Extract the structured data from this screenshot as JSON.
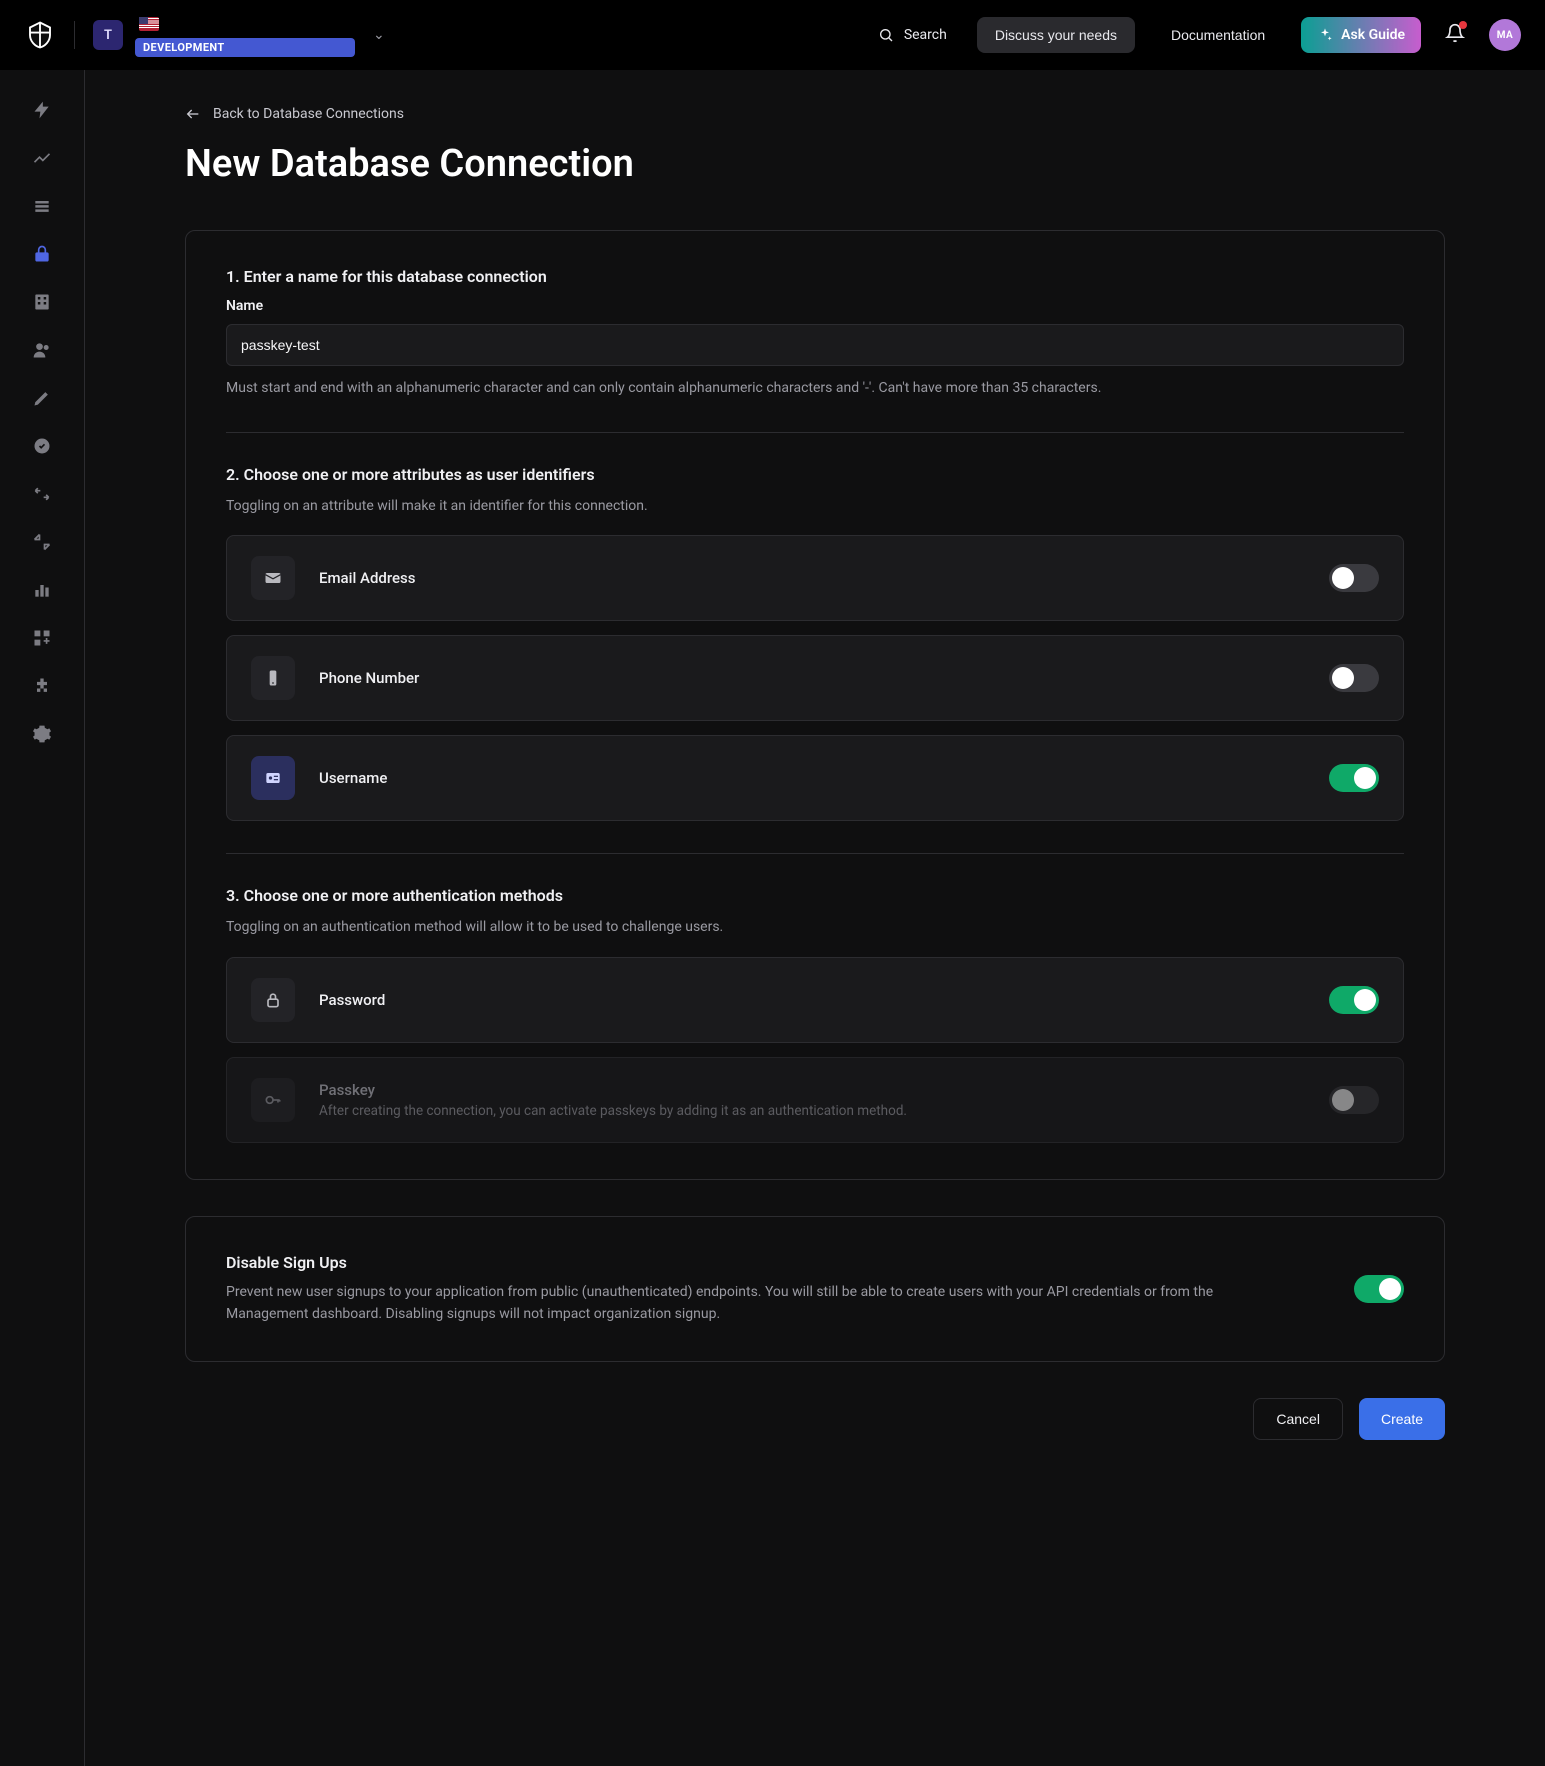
{
  "header": {
    "tenant_initial": "T",
    "env_badge": "DEVELOPMENT",
    "search_label": "Search",
    "discuss_label": "Discuss your needs",
    "docs_label": "Documentation",
    "ask_guide_label": "Ask Guide",
    "avatar_initials": "MA"
  },
  "back_link": "Back to Database Connections",
  "page_title": "New Database Connection",
  "section1": {
    "heading": "1. Enter a name for this database connection",
    "label": "Name",
    "value": "passkey-test",
    "hint": "Must start and end with an alphanumeric character and can only contain alphanumeric characters and '-'. Can't have more than 35 characters."
  },
  "section2": {
    "heading": "2. Choose one or more attributes as user identifiers",
    "sub": "Toggling on an attribute will make it an identifier for this connection.",
    "rows": [
      {
        "label": "Email Address",
        "on": false
      },
      {
        "label": "Phone Number",
        "on": false
      },
      {
        "label": "Username",
        "on": true
      }
    ]
  },
  "section3": {
    "heading": "3. Choose one or more authentication methods",
    "sub": "Toggling on an authentication method will allow it to be used to challenge users.",
    "rows": [
      {
        "label": "Password",
        "on": true
      },
      {
        "label": "Passkey",
        "desc": "After creating the connection, you can activate passkeys by adding it as an authentication method.",
        "on": false,
        "disabled": true
      }
    ]
  },
  "signup": {
    "title": "Disable Sign Ups",
    "desc": "Prevent new user signups to your application from public (unauthenticated) endpoints. You will still be able to create users with your API credentials or from the Management dashboard. Disabling signups will not impact organization signup.",
    "on": true
  },
  "footer": {
    "cancel": "Cancel",
    "create": "Create"
  }
}
